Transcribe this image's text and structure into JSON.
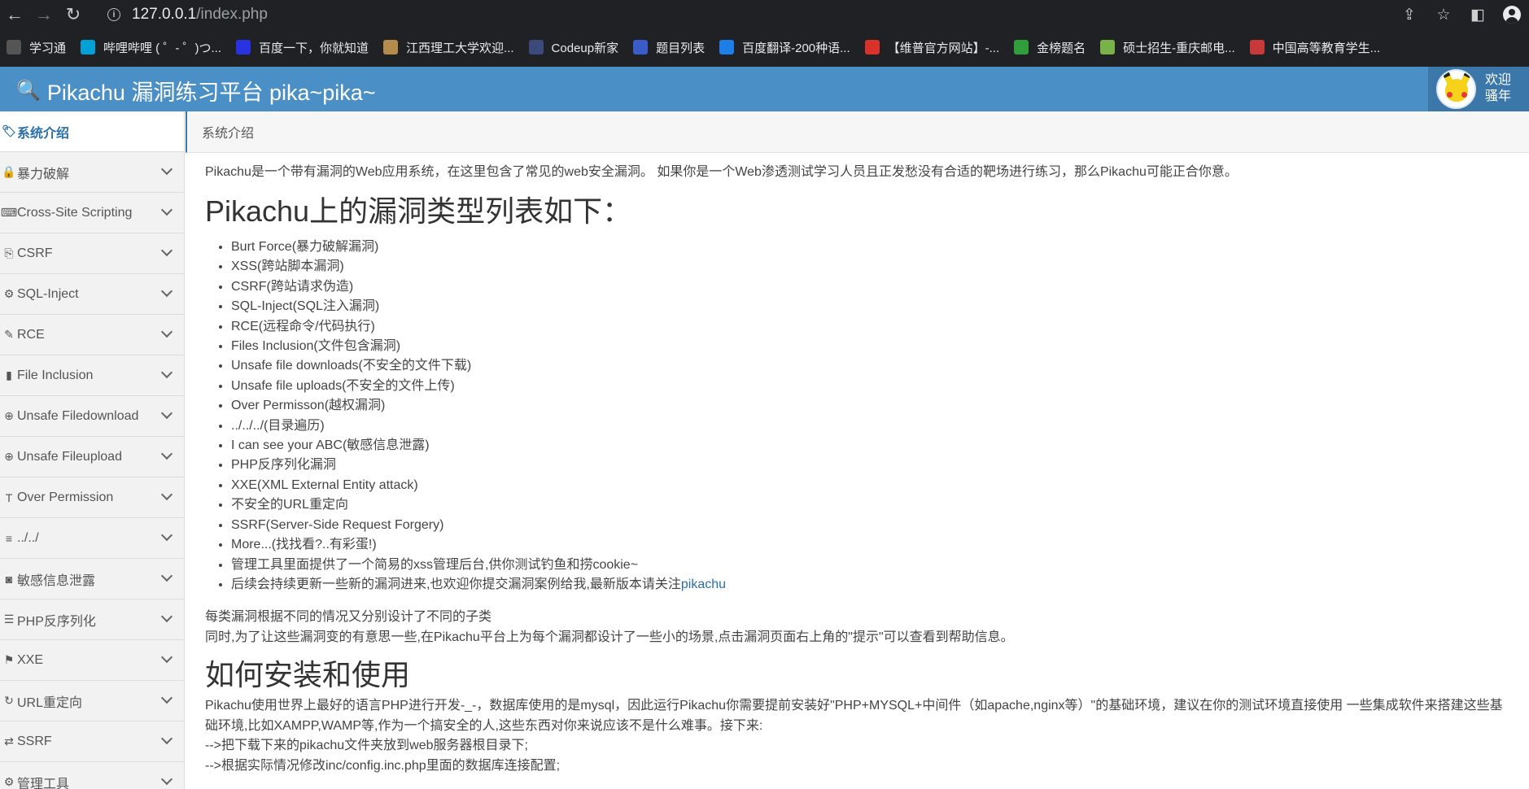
{
  "browser": {
    "url_host": "127.0.0.1",
    "url_path": "/index.php",
    "bookmarks": [
      {
        "label": "学习通",
        "color": "#555555"
      },
      {
        "label": "哔哩哔哩 ( ゜- ゜)つ...",
        "color": "#00a1d6"
      },
      {
        "label": "百度一下，你就知道",
        "color": "#2932e1"
      },
      {
        "label": "江西理工大学欢迎...",
        "color": "#b38b4a"
      },
      {
        "label": "Codeup新家",
        "color": "#3b4a7a"
      },
      {
        "label": "题目列表",
        "color": "#3a5cc8"
      },
      {
        "label": "百度翻译-200种语...",
        "color": "#1e7ee8"
      },
      {
        "label": "【维普官方网站】-...",
        "color": "#d8322a"
      },
      {
        "label": "金榜题名",
        "color": "#2f9e3b"
      },
      {
        "label": "硕士招生-重庆邮电...",
        "color": "#7ab24a"
      },
      {
        "label": "中国高等教育学生...",
        "color": "#c83a3a"
      }
    ]
  },
  "header": {
    "title": "Pikachu 漏洞练习平台 pika~pika~",
    "greet_line1": "欢迎",
    "greet_line2": "骚年",
    "bg_color": "#4a8fc5"
  },
  "sidebar": {
    "items": [
      {
        "label": "系统介绍",
        "icon": "tag-icon",
        "glyph": "🏷"
      },
      {
        "label": "暴力破解",
        "icon": "lock-icon",
        "glyph": "🔒"
      },
      {
        "label": "Cross-Site Scripting",
        "icon": "code-icon",
        "glyph": "⌨"
      },
      {
        "label": "CSRF",
        "icon": "share-icon",
        "glyph": "⎘"
      },
      {
        "label": "SQL-Inject",
        "icon": "fire-icon",
        "glyph": "⚙"
      },
      {
        "label": "RCE",
        "icon": "pencil-icon",
        "glyph": "✎"
      },
      {
        "label": "File Inclusion",
        "icon": "file-icon",
        "glyph": "▮"
      },
      {
        "label": "Unsafe Filedownload",
        "icon": "download-icon",
        "glyph": "⊕"
      },
      {
        "label": "Unsafe Fileupload",
        "icon": "upload-icon",
        "glyph": "⊕"
      },
      {
        "label": "Over Permission",
        "icon": "text-height-icon",
        "glyph": "T"
      },
      {
        "label": "../../",
        "icon": "align-icon",
        "glyph": "≡"
      },
      {
        "label": "敏感信息泄露",
        "icon": "camera-icon",
        "glyph": "◙"
      },
      {
        "label": "PHP反序列化",
        "icon": "list-icon",
        "glyph": "☰"
      },
      {
        "label": "XXE",
        "icon": "flag-icon",
        "glyph": "⚑"
      },
      {
        "label": "URL重定向",
        "icon": "refresh-icon",
        "glyph": "↻"
      },
      {
        "label": "SSRF",
        "icon": "exchange-icon",
        "glyph": "⇄"
      },
      {
        "label": "管理工具",
        "icon": "gear-icon",
        "glyph": "⚙"
      }
    ]
  },
  "breadcrumb": "系统介绍",
  "content": {
    "intro": "Pikachu是一个带有漏洞的Web应用系统，在这里包含了常见的web安全漏洞。 如果你是一个Web渗透测试学习人员且正发愁没有合适的靶场进行练习，那么Pikachu可能正合你意。",
    "vuln_heading": "Pikachu上的漏洞类型列表如下：",
    "vuln_list": [
      "Burt Force(暴力破解漏洞)",
      "XSS(跨站脚本漏洞)",
      "CSRF(跨站请求伪造)",
      "SQL-Inject(SQL注入漏洞)",
      "RCE(远程命令/代码执行)",
      "Files Inclusion(文件包含漏洞)",
      "Unsafe file downloads(不安全的文件下载)",
      "Unsafe file uploads(不安全的文件上传)",
      "Over Permisson(越权漏洞)",
      "../../../(目录遍历)",
      "I can see your ABC(敏感信息泄露)",
      "PHP反序列化漏洞",
      "XXE(XML External Entity attack)",
      "不安全的URL重定向",
      "SSRF(Server-Side Request Forgery)",
      "More...(找找看?..有彩蛋!)",
      "管理工具里面提供了一个简易的xss管理后台,供你测试钓鱼和捞cookie~"
    ],
    "last_item_prefix": "后续会持续更新一些新的漏洞进来,也欢迎你提交漏洞案例给我,最新版本请关注",
    "last_item_link": "pikachu",
    "sub_para1": "每类漏洞根据不同的情况又分别设计了不同的子类",
    "sub_para2": "同时,为了让这些漏洞变的有意思一些,在Pikachu平台上为每个漏洞都设计了一些小的场景,点击漏洞页面右上角的\"提示\"可以查看到帮助信息。",
    "install_heading": "如何安装和使用",
    "install_para1": "Pikachu使用世界上最好的语言PHP进行开发-_-，数据库使用的是mysql，因此运行Pikachu你需要提前安装好\"PHP+MYSQL+中间件（如apache,nginx等）\"的基础环境，建议在你的测试环境直接使用 一些集成软件来搭建这些基础环境,比如XAMPP,WAMP等,作为一个搞安全的人,这些东西对你来说应该不是什么难事。接下来:",
    "install_step1": "-->把下载下来的pikachu文件夹放到web服务器根目录下;",
    "install_step2": "-->根据实际情况修改inc/config.inc.php里面的数据库连接配置;"
  }
}
